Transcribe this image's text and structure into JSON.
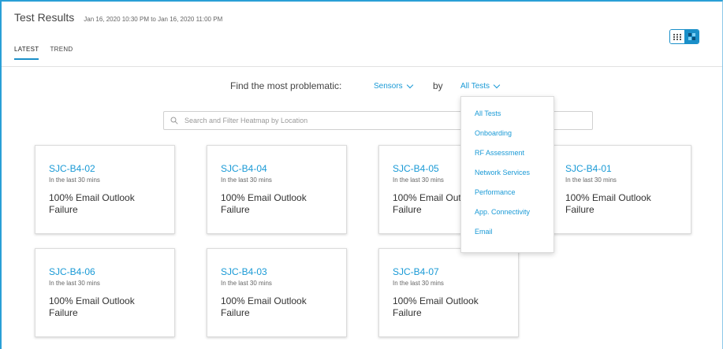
{
  "header": {
    "title": "Test Results",
    "date_range": "Jan 16, 2020 10:30 PM to Jan 16, 2020 11:00 PM"
  },
  "view_toggle": {
    "options": [
      {
        "icon": "grid-list-icon",
        "selected": false
      },
      {
        "icon": "heatmap-icon",
        "selected": true
      }
    ]
  },
  "tabs": [
    {
      "label": "LATEST",
      "active": true
    },
    {
      "label": "TREND",
      "active": false
    }
  ],
  "finder": {
    "label": "Find the most problematic:",
    "entity_selected": "Sensors",
    "by_label": "by",
    "test_selected": "All Tests"
  },
  "search": {
    "placeholder": "Search and Filter Heatmap by Location",
    "value": ""
  },
  "dropdown_menu": {
    "items": [
      "All Tests",
      "Onboarding",
      "RF Assessment",
      "Network Services",
      "Performance",
      "App. Connectivity",
      "Email"
    ]
  },
  "cards": [
    {
      "name": "SJC-B4-02",
      "period": "In the last 30 mins",
      "failure": "100% Email Outlook Failure"
    },
    {
      "name": "SJC-B4-04",
      "period": "In the last 30 mins",
      "failure": "100% Email Outlook Failure"
    },
    {
      "name": "SJC-B4-05",
      "period": "In the last 30 mins",
      "failure": "100% Email Outlook Failure"
    },
    {
      "name": "SJC-B4-01",
      "period": "In the last 30 mins",
      "failure": "100% Email Outlook Failure"
    },
    {
      "name": "SJC-B4-06",
      "period": "In the last 30 mins",
      "failure": "100% Email Outlook Failure"
    },
    {
      "name": "SJC-B4-03",
      "period": "In the last 30 mins",
      "failure": "100% Email Outlook Failure"
    },
    {
      "name": "SJC-B4-07",
      "period": "In the last 30 mins",
      "failure": "100% Email Outlook Failure"
    }
  ],
  "colors": {
    "accent": "#1a9ad6",
    "border_accent": "#2a9fd6"
  }
}
